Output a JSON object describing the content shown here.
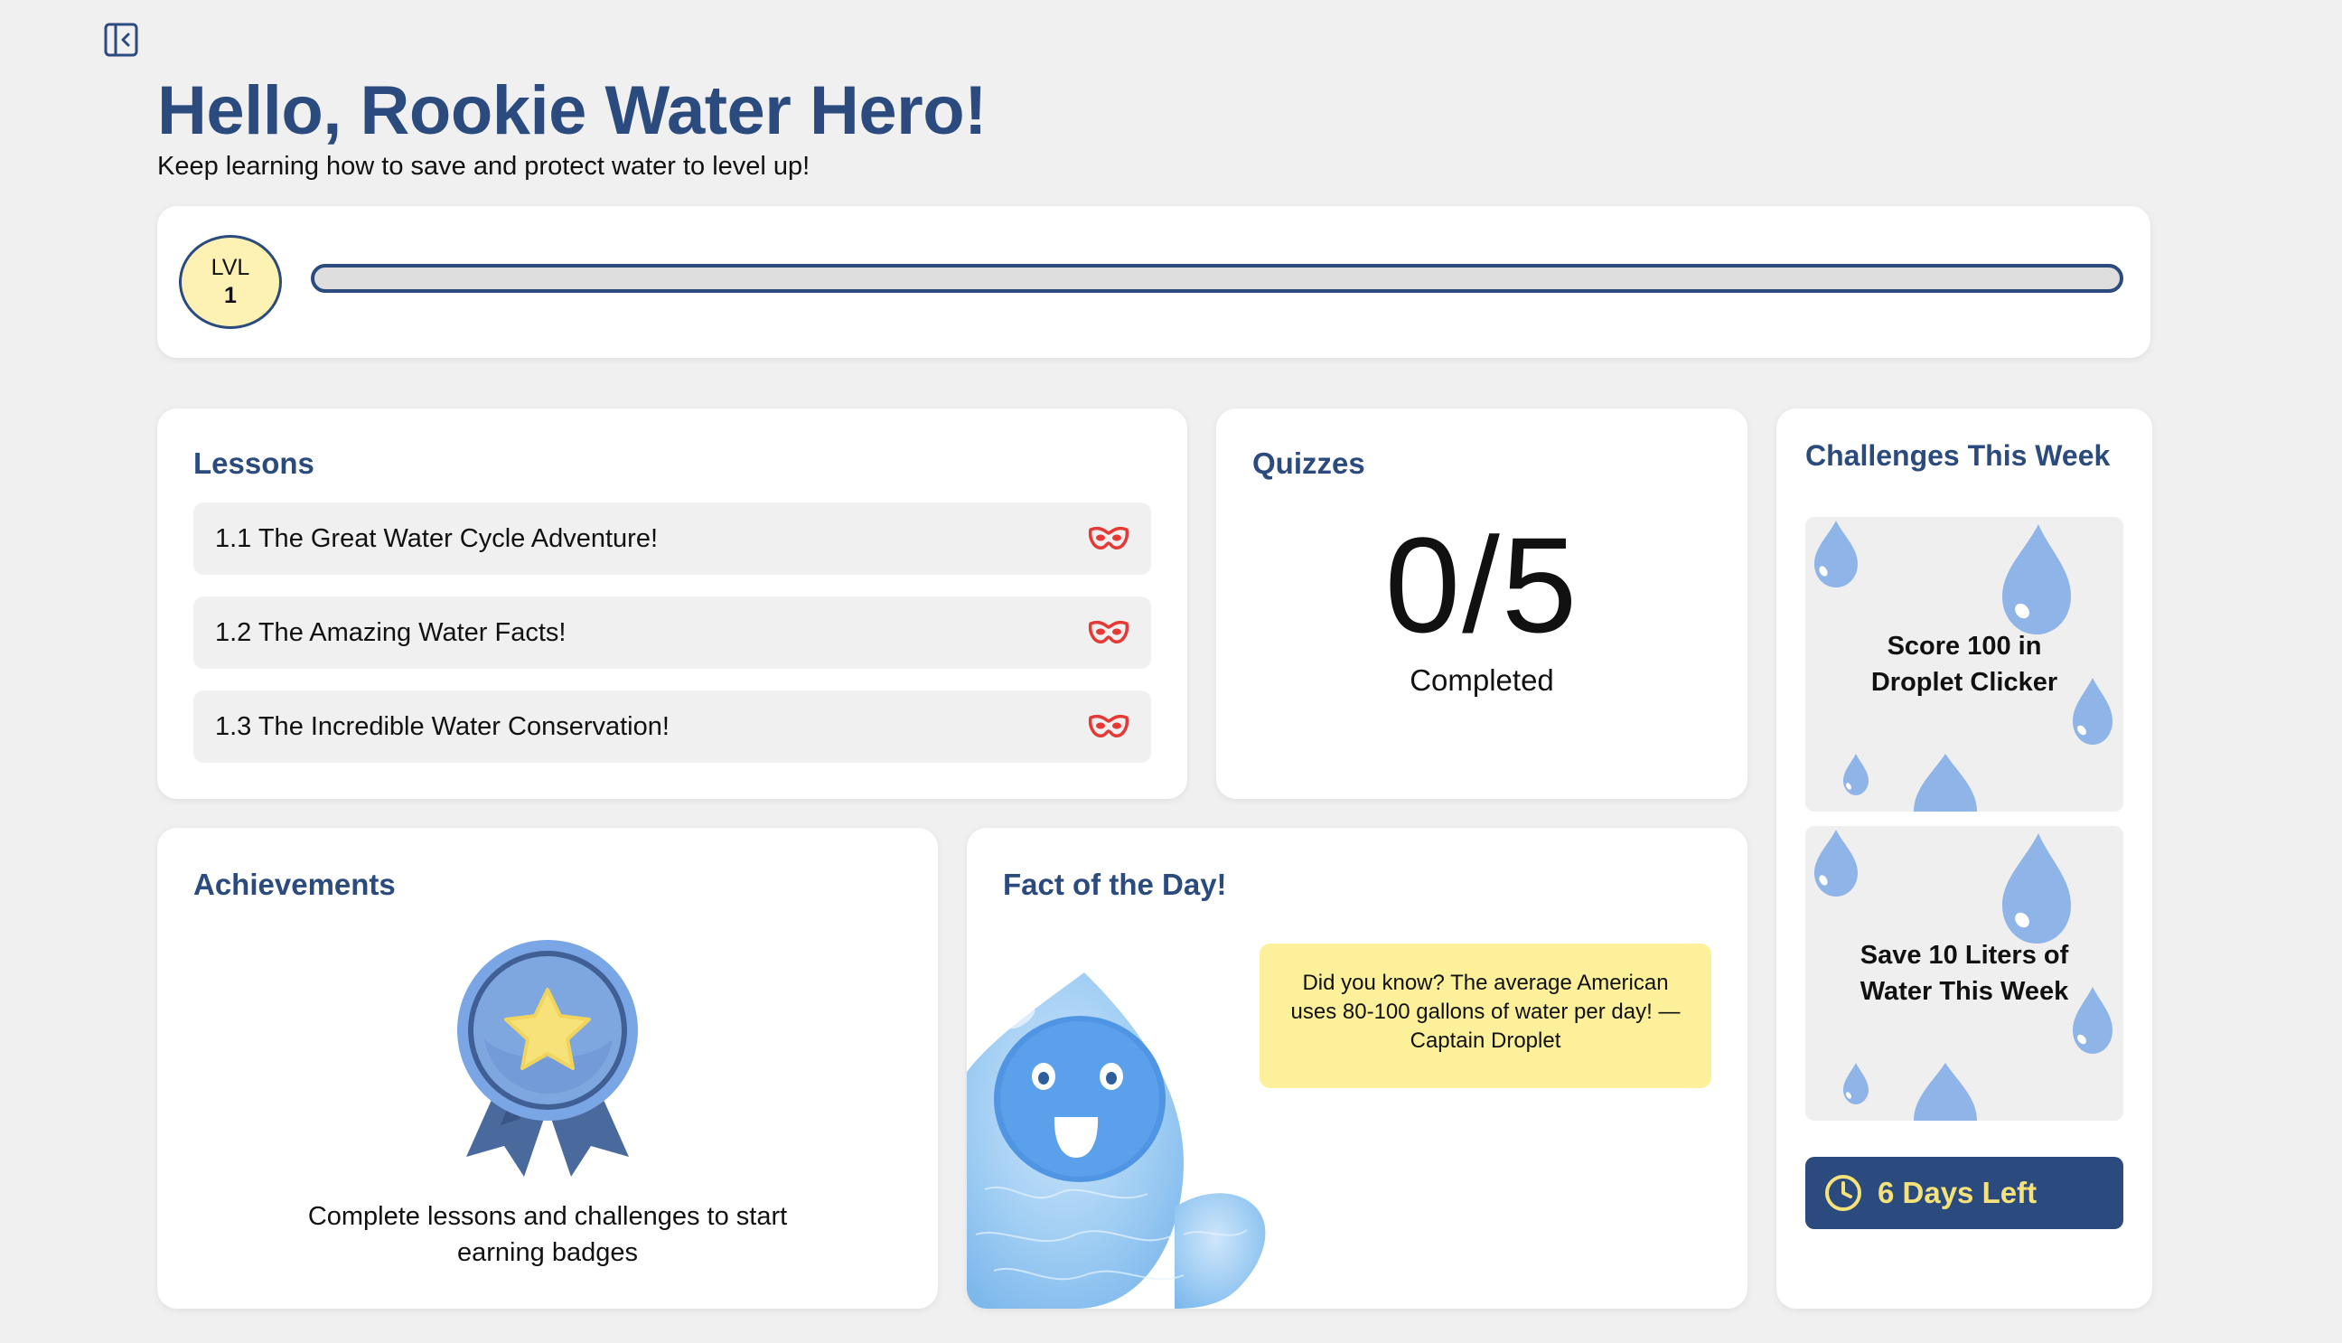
{
  "header": {
    "title": "Hello, Rookie Water Hero!",
    "subtitle": "Keep learning how to save and protect water to level up!"
  },
  "icons": {
    "sidebar_toggle": "sidebar-collapse-icon",
    "lesson_status": "mask-icon",
    "timer": "clock-icon",
    "achievement": "medal-icon"
  },
  "level": {
    "label": "LVL",
    "number": "1",
    "progress_percent": 0
  },
  "lessons": {
    "title": "Lessons",
    "items": [
      {
        "label": "1.1 The Great Water Cycle Adventure!"
      },
      {
        "label": "1.2 The Amazing Water Facts!"
      },
      {
        "label": "1.3 The Incredible Water Conservation!"
      }
    ]
  },
  "quizzes": {
    "title": "Quizzes",
    "count": "0/5",
    "status": "Completed"
  },
  "challenges": {
    "title": "Challenges This Week",
    "items": [
      {
        "label": "Score 100 in Droplet Clicker"
      },
      {
        "label": "Save 10 Liters of Water This Week"
      }
    ],
    "days_left": "6 Days Left"
  },
  "achievements": {
    "title": "Achievements",
    "caption": "Complete lessons and challenges to start earning badges"
  },
  "fact": {
    "title": "Fact of the Day!",
    "text": "Did you know? The average American uses 80-100 gallons of water per day! —Captain Droplet"
  },
  "colors": {
    "primary": "#2b4a7d",
    "background": "#f0f0f0",
    "card": "#ffffff",
    "level_badge": "#fdf2b4",
    "fact_bubble": "#fdf09a",
    "accent_yellow": "#f5e27a",
    "lesson_icon": "#e53935",
    "droplet": "#8fb4e8"
  }
}
